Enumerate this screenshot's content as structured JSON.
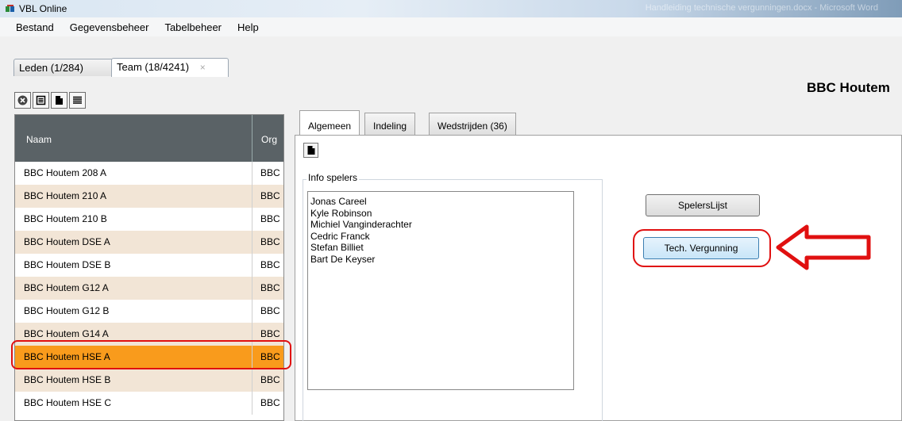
{
  "window": {
    "title": "VBL Online",
    "right_title": "Handleiding technische vergunningen.docx - Microsoft Word"
  },
  "menu": [
    "Bestand",
    "Gegevensbeheer",
    "Tabelbeheer",
    "Help"
  ],
  "top_tabs": [
    {
      "label": "Leden (1/284)"
    },
    {
      "label": "Team (18/4241)",
      "close": "×"
    }
  ],
  "org_name": "BBC Houtem",
  "list": {
    "columns": [
      "Naam",
      "Org"
    ],
    "rows": [
      {
        "name": "BBC Houtem 208 A",
        "org": "BBC"
      },
      {
        "name": "BBC Houtem 210 A",
        "org": "BBC"
      },
      {
        "name": "BBC Houtem 210 B",
        "org": "BBC"
      },
      {
        "name": "BBC Houtem DSE A",
        "org": "BBC"
      },
      {
        "name": "BBC Houtem DSE B",
        "org": "BBC"
      },
      {
        "name": "BBC Houtem G12 A",
        "org": "BBC"
      },
      {
        "name": "BBC Houtem G12 B",
        "org": "BBC"
      },
      {
        "name": "BBC Houtem G14 A",
        "org": "BBC"
      },
      {
        "name": "BBC Houtem HSE A",
        "org": "BBC"
      },
      {
        "name": "BBC Houtem HSE B",
        "org": "BBC"
      },
      {
        "name": "BBC Houtem HSE C",
        "org": "BBC"
      }
    ],
    "selected_index": 8
  },
  "sub_tabs": [
    "Algemeen",
    "Indeling",
    "Wedstrijden (36)"
  ],
  "info": {
    "legend": "Info spelers",
    "players": [
      "Jonas Careel",
      "Kyle Robinson",
      "Michiel Vanginderachter",
      "Cedric Franck",
      "Stefan Billiet",
      "Bart De Keyser"
    ]
  },
  "buttons": {
    "spelers": "SpelersLijst",
    "tech": "Tech. Vergunning"
  },
  "colors": {
    "selected_row": "#f99b1c",
    "alt_row": "#f2e5d6",
    "header": "#5a6266",
    "annotation": "#e01010"
  }
}
